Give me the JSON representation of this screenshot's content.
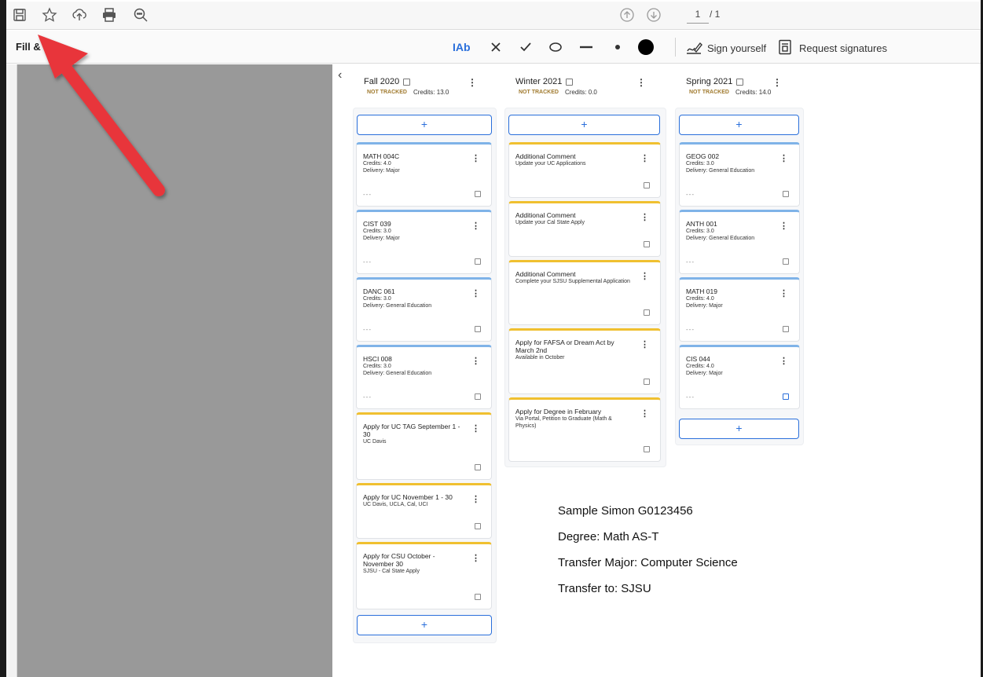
{
  "toolbar": {
    "icons": [
      "save-icon",
      "star-icon",
      "cloud-upload-icon",
      "print-icon",
      "zoom-icon"
    ],
    "page_current": "1",
    "page_total": "/ 1"
  },
  "fill_bar": {
    "label": "Fill &",
    "text_tool": "IAb",
    "sign_yourself": "Sign yourself",
    "request_signatures": "Request signatures"
  },
  "columns": [
    {
      "title": "Fall 2020",
      "status": "NOT TRACKED",
      "credits": "Credits: 13.0",
      "add_label": "+",
      "cards": [
        {
          "title": "MATH 004C",
          "lines": [
            "Credits: 4.0",
            "Delivery: Major"
          ],
          "color": "blue",
          "dots": "---"
        },
        {
          "title": "CIST 039",
          "lines": [
            "Credits: 3.0",
            "Delivery: Major"
          ],
          "color": "blue",
          "dots": "---"
        },
        {
          "title": "DANC 061",
          "lines": [
            "Credits: 3.0",
            "Delivery: General Education"
          ],
          "color": "blue",
          "dots": "---"
        },
        {
          "title": "HSCI 008",
          "lines": [
            "Credits: 3.0",
            "Delivery: General Education"
          ],
          "color": "blue",
          "dots": "---"
        },
        {
          "title": "Apply for UC TAG September 1 - 30",
          "lines": [
            "UC Davis"
          ],
          "color": "yellow"
        },
        {
          "title": "Apply for UC November 1 - 30",
          "lines": [
            "UC Davis, UCLA, Cal, UCI"
          ],
          "color": "yellow"
        },
        {
          "title": "Apply for CSU October - November 30",
          "lines": [
            "SJSU - Cal State Apply"
          ],
          "color": "yellow"
        }
      ]
    },
    {
      "title": "Winter 2021",
      "status": "NOT TRACKED",
      "credits": "Credits: 0.0",
      "add_label": "+",
      "cards": [
        {
          "title": "Additional Comment",
          "lines": [
            "Update your UC Applications"
          ],
          "color": "yellow"
        },
        {
          "title": "Additional Comment",
          "lines": [
            "Update your Cal State Apply"
          ],
          "color": "yellow"
        },
        {
          "title": "Additional Comment",
          "lines": [
            "Complete your SJSU Supplemental Application"
          ],
          "color": "yellow"
        },
        {
          "title": "Apply for FAFSA or Dream Act by March 2nd",
          "lines": [
            "Available in October"
          ],
          "color": "yellow"
        },
        {
          "title": "Apply for Degree in February",
          "lines": [
            "Via Portal, Petition to Graduate (Math & Physics)"
          ],
          "color": "yellow"
        }
      ]
    },
    {
      "title": "Spring 2021",
      "status": "NOT TRACKED",
      "credits": "Credits: 14.0",
      "add_label": "+",
      "cards": [
        {
          "title": "GEOG 002",
          "lines": [
            "Credits: 3.0",
            "Delivery: General Education"
          ],
          "color": "blue",
          "dots": "---"
        },
        {
          "title": "ANTH 001",
          "lines": [
            "Credits: 3.0",
            "Delivery: General Education"
          ],
          "color": "blue",
          "dots": "---"
        },
        {
          "title": "MATH 019",
          "lines": [
            "Credits: 4.0",
            "Delivery: Major"
          ],
          "color": "blue",
          "dots": "---"
        },
        {
          "title": "CIS 044",
          "lines": [
            "Credits: 4.0",
            "Delivery: Major"
          ],
          "color": "blue",
          "dots": "---"
        }
      ]
    }
  ],
  "student_info": {
    "name": "Sample Simon G0123456",
    "degree": "Degree: Math AS-T",
    "major": "Transfer Major: Computer Science",
    "transfer_to": "Transfer to: SJSU"
  },
  "annotation": {
    "arrow_color": "#e8363a"
  }
}
